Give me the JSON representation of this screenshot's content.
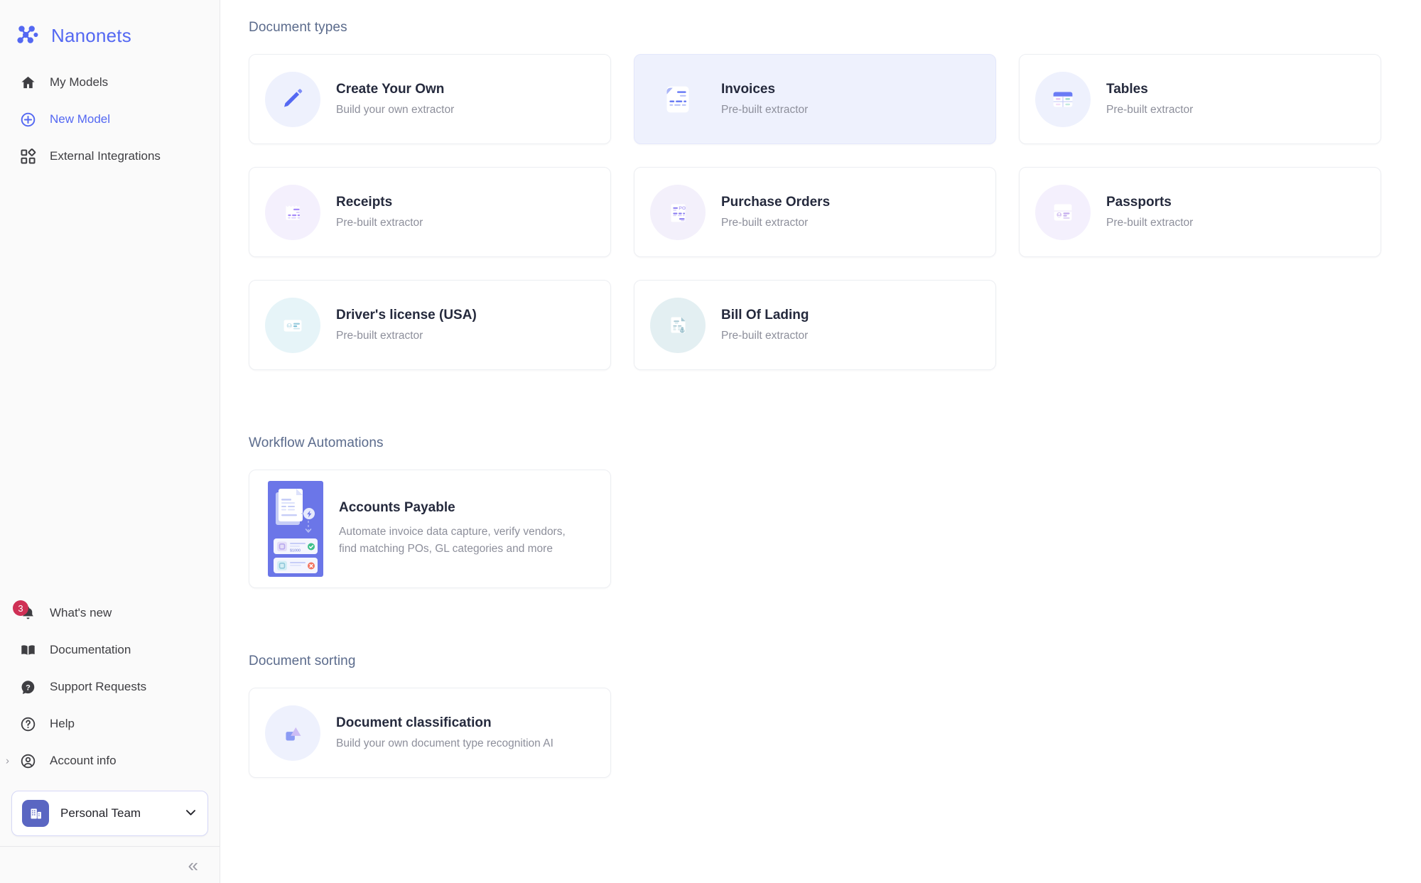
{
  "sidebar": {
    "brand": {
      "name": "Nanonets",
      "logo_icon": "nanonets-network-logo"
    },
    "nav_top": [
      {
        "label": "My Models",
        "icon": "home-icon",
        "active": false
      },
      {
        "label": "New Model",
        "icon": "plus-circle-icon",
        "active": true
      },
      {
        "label": "External Integrations",
        "icon": "integrations-grid-icon",
        "active": false
      }
    ],
    "nav_bottom": [
      {
        "label": "What's new",
        "icon": "bell-icon",
        "badge": "3"
      },
      {
        "label": "Documentation",
        "icon": "book-icon",
        "badge": ""
      },
      {
        "label": "Support Requests",
        "icon": "question-chat-icon",
        "badge": ""
      },
      {
        "label": "Help",
        "icon": "question-circle-icon",
        "badge": ""
      },
      {
        "label": "Account info",
        "icon": "user-circle-icon",
        "badge": "",
        "expand_chevron": "›"
      }
    ],
    "team": {
      "name": "Personal Team",
      "avatar_icon": "building-icon",
      "chevron_icon": "chevron-down-icon"
    },
    "collapse": {
      "icon": "double-chevron-left-icon",
      "glyph": "«"
    }
  },
  "main": {
    "sections": {
      "document_types": {
        "title": "Document types",
        "cards": [
          {
            "title": "Create Your Own",
            "subtitle": "Build your own extractor",
            "icon": "pencil-icon",
            "tone": "blue",
            "selected": false
          },
          {
            "title": "Invoices",
            "subtitle": "Pre-built extractor",
            "icon": "invoice-document-icon",
            "tone": "blue2",
            "selected": true
          },
          {
            "title": "Tables",
            "subtitle": "Pre-built extractor",
            "icon": "table-grid-icon",
            "tone": "blue",
            "selected": false
          },
          {
            "title": "Receipts",
            "subtitle": "Pre-built extractor",
            "icon": "receipt-icon",
            "tone": "purple",
            "selected": false
          },
          {
            "title": "Purchase Orders",
            "subtitle": "Pre-built extractor",
            "icon": "purchase-order-icon",
            "tone": "purple2",
            "selected": false
          },
          {
            "title": "Passports",
            "subtitle": "Pre-built extractor",
            "icon": "passport-id-icon",
            "tone": "purple",
            "selected": false
          },
          {
            "title": "Driver's license (USA)",
            "subtitle": "Pre-built extractor",
            "icon": "drivers-license-icon",
            "tone": "teal",
            "selected": false
          },
          {
            "title": "Bill Of Lading",
            "subtitle": "Pre-built extractor",
            "icon": "bill-of-lading-anchor-icon",
            "tone": "teal2",
            "selected": false
          }
        ]
      },
      "workflow_automations": {
        "title": "Workflow Automations",
        "card": {
          "title": "Accounts Payable",
          "description": "Automate invoice data capture, verify vendors, find matching POs, GL categories and more",
          "illustration": "accounts-payable-illustration",
          "illustration_amount": "$1000"
        }
      },
      "document_sorting": {
        "title": "Document sorting",
        "card": {
          "title": "Document classification",
          "subtitle": "Build your own document type recognition AI",
          "icon": "shapes-classification-icon",
          "tone": "blue"
        }
      }
    }
  },
  "colors": {
    "brand": "#5468f2",
    "badge": "#cf3055",
    "selected_card_bg": "#eef1fd",
    "section_title": "#5b6b8c",
    "card_title": "#252a3d",
    "card_subtitle": "#8d8f9b",
    "team_avatar": "#5a66c2"
  }
}
